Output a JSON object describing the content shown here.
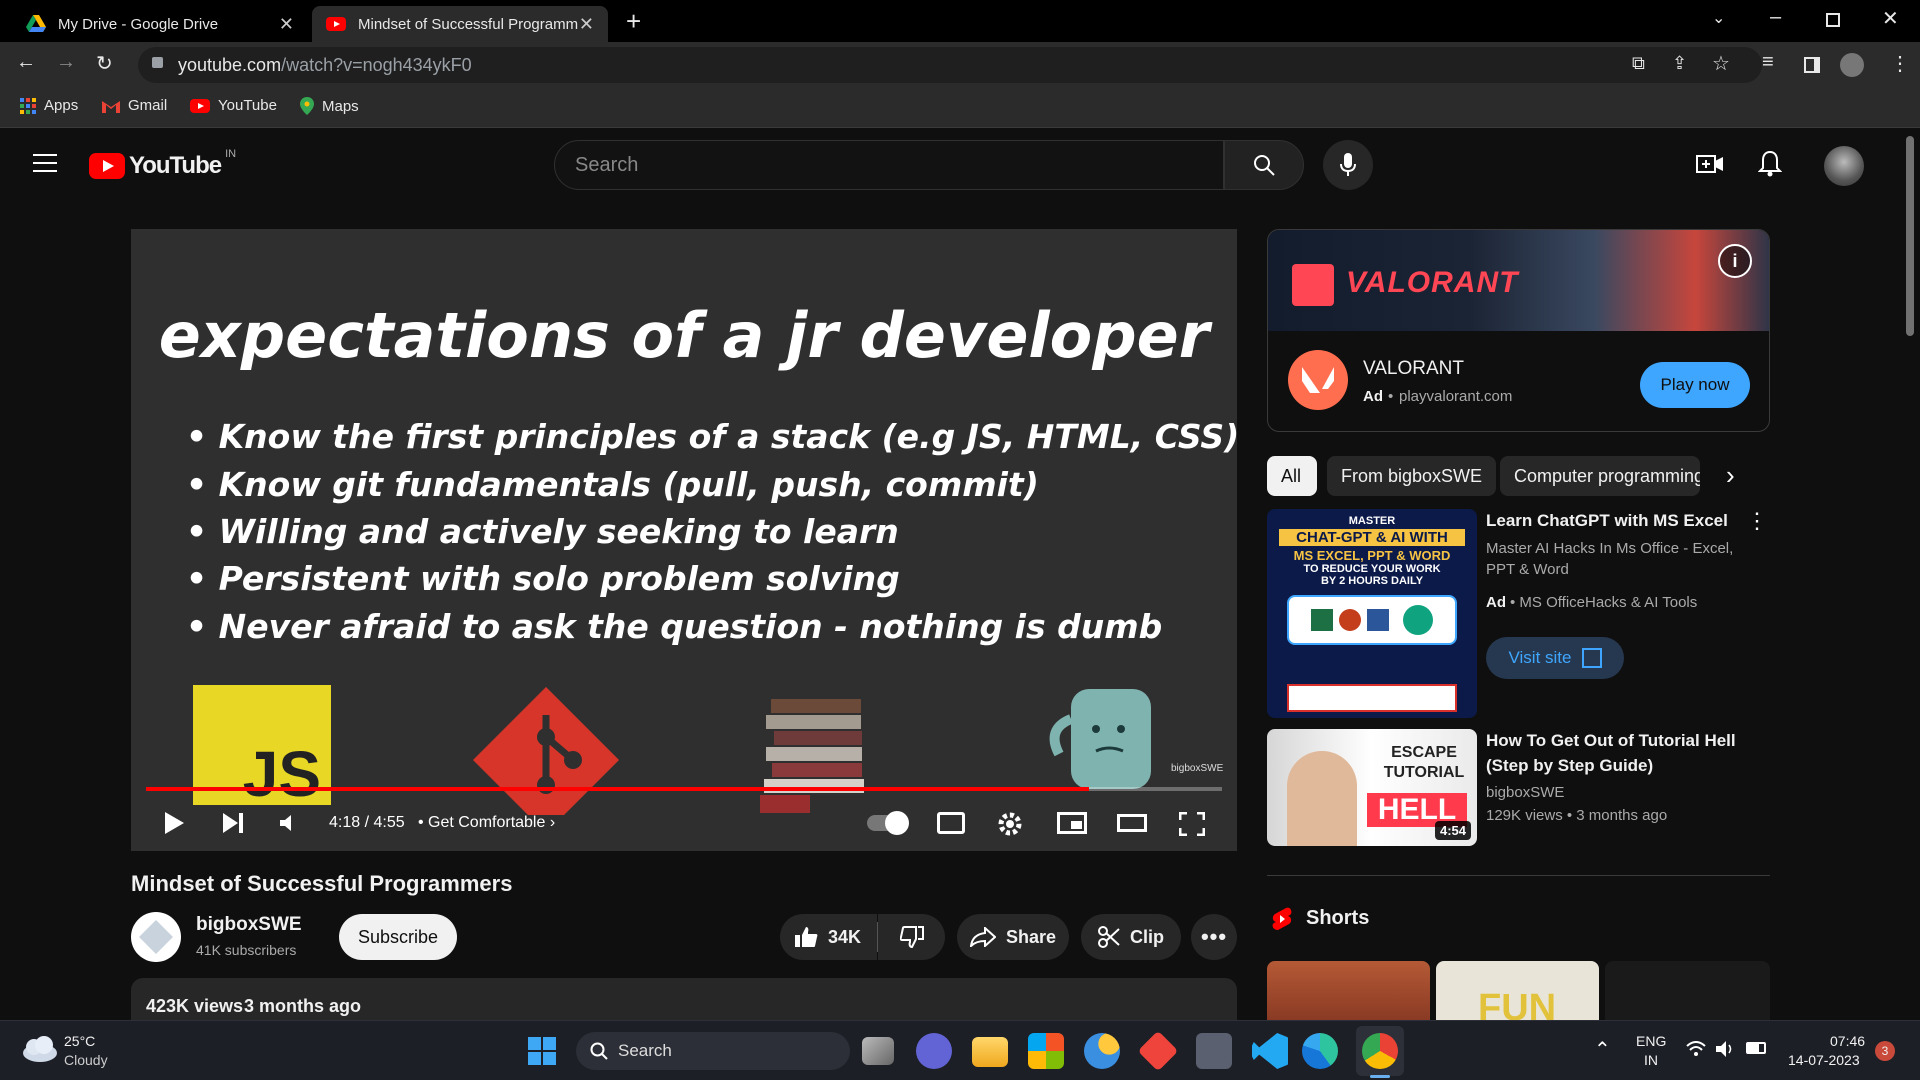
{
  "browser": {
    "tabs": [
      {
        "label": "My Drive - Google Drive"
      },
      {
        "label": "Mindset of Successful Programm"
      }
    ],
    "url_host": "youtube.com",
    "url_path": "/watch?v=nogh434ykF0",
    "bookmarks": [
      "Apps",
      "Gmail",
      "YouTube",
      "Maps"
    ]
  },
  "youtube": {
    "logo_text": "YouTube",
    "country": "IN",
    "search_placeholder": "Search"
  },
  "video": {
    "slide_title": "expectations of a jr developer",
    "bullets": [
      "Know the first principles of a stack (e.g JS, HTML, CSS)",
      "Know git fundamentals (pull, push, commit)",
      "Willing and actively seeking to learn",
      "Persistent with solo problem solving",
      "Never afraid to ask the question - nothing is dumb"
    ],
    "js_logo": "JS",
    "watermark": "bigboxSWE",
    "time": "4:18 / 4:55",
    "chapter": "Get Comfortable",
    "progress_fraction": 0.876,
    "title": "Mindset of Successful Programmers",
    "channel": "bigboxSWE",
    "subscribers": "41K subscribers",
    "subscribe_label": "Subscribe",
    "likes": "34K",
    "share_label": "Share",
    "clip_label": "Clip",
    "views": "423K views",
    "age": "3 months ago"
  },
  "ad": {
    "banner_text": "VALORANT",
    "name": "VALORANT",
    "ad_label": "Ad",
    "domain": "playvalorant.com",
    "cta": "Play now"
  },
  "chips": [
    "All",
    "From bigboxSWE",
    "Computer programming"
  ],
  "related": [
    {
      "title": "Learn ChatGPT with MS Excel",
      "description": "Master AI Hacks In Ms Office - Excel, PPT & Word",
      "ad_label": "Ad",
      "advertiser": "MS OfficeHacks & AI Tools",
      "cta": "Visit site",
      "thumb_lines": [
        "MASTER",
        "CHAT-GPT & AI WITH",
        "MS EXCEL, PPT & WORD",
        "TO REDUCE YOUR WORK",
        "BY 2 HOURS DAILY"
      ]
    },
    {
      "title": "How To Get Out of Tutorial Hell (Step by Step Guide)",
      "channel": "bigboxSWE",
      "meta": "129K views • 3 months ago",
      "duration": "4:54",
      "thumb_text_1": "ESCAPE TUTORIAL",
      "thumb_text_2": "HELL"
    }
  ],
  "shorts_label": "Shorts",
  "shorts_thumb_text": "FUN",
  "taskbar": {
    "temp": "25°C",
    "weather": "Cloudy",
    "search": "Search",
    "lang1": "ENG",
    "lang2": "IN",
    "time": "07:46",
    "date": "14-07-2023",
    "notif_count": "3"
  },
  "colors": {
    "youtube_red": "#ff0000",
    "accent_blue": "#3ea6ff",
    "valorant_red": "#ff4655"
  }
}
